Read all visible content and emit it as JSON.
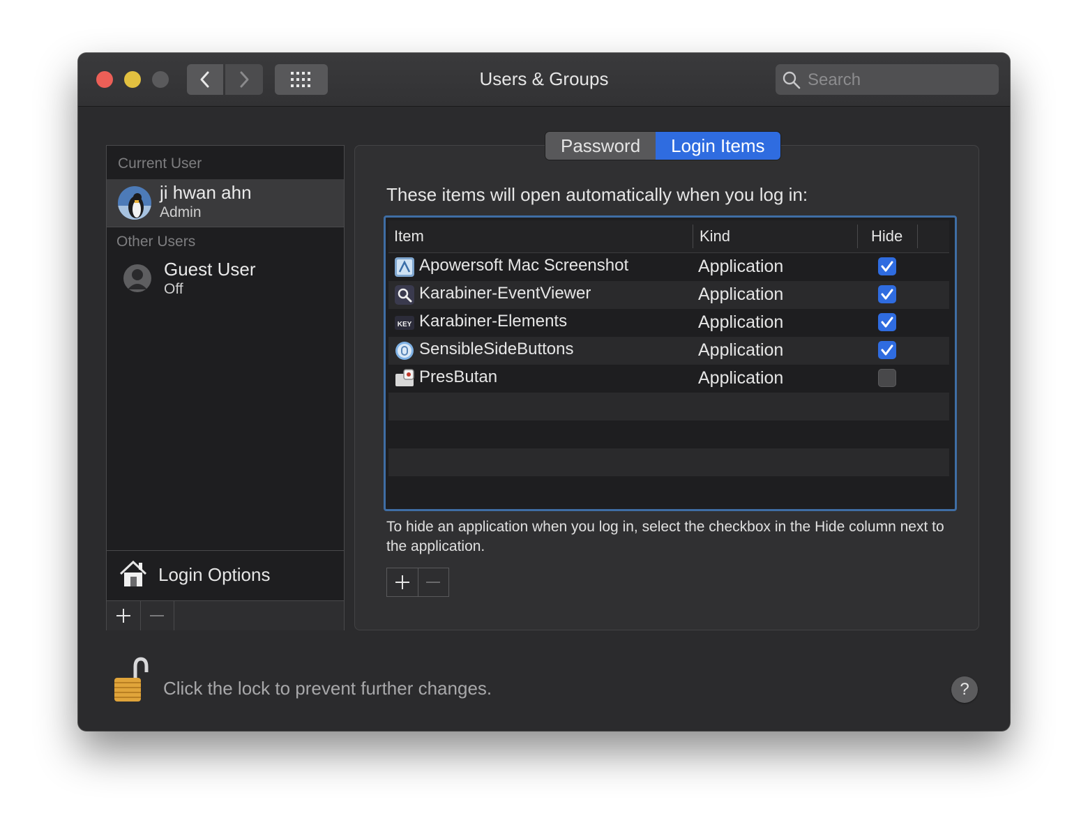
{
  "window": {
    "title": "Users & Groups",
    "search_placeholder": "Search"
  },
  "sidebar": {
    "current_user_header": "Current User",
    "current_user": {
      "name": "ji hwan ahn",
      "role": "Admin"
    },
    "other_users_header": "Other Users",
    "other_users": [
      {
        "name": "Guest User",
        "status": "Off"
      }
    ],
    "login_options_label": "Login Options"
  },
  "tabs": [
    {
      "label": "Password",
      "active": false
    },
    {
      "label": "Login Items",
      "active": true
    }
  ],
  "login_items": {
    "intro": "These items will open automatically when you log in:",
    "columns": {
      "item": "Item",
      "kind": "Kind",
      "hide": "Hide"
    },
    "rows": [
      {
        "name": "Apowersoft Mac Screenshot",
        "kind": "Application",
        "hide": true,
        "icon": "apowersoft-app-icon"
      },
      {
        "name": "Karabiner-EventViewer",
        "kind": "Application",
        "hide": true,
        "icon": "karabiner-eventviewer-app-icon"
      },
      {
        "name": "Karabiner-Elements",
        "kind": "Application",
        "hide": true,
        "icon": "karabiner-elements-app-icon"
      },
      {
        "name": "SensibleSideButtons",
        "kind": "Application",
        "hide": true,
        "icon": "sensiblesidebuttons-app-icon"
      },
      {
        "name": "PresButan",
        "kind": "Application",
        "hide": false,
        "icon": "presbutan-app-icon"
      }
    ],
    "hint": "To hide an application when you log in, select the checkbox in the Hide column next to the application."
  },
  "footer": {
    "lock_text": "Click the lock to prevent further changes.",
    "help_label": "?"
  },
  "colors": {
    "accent": "#2f6ce0",
    "close": "#ec5f57",
    "minimize": "#e2c040"
  }
}
